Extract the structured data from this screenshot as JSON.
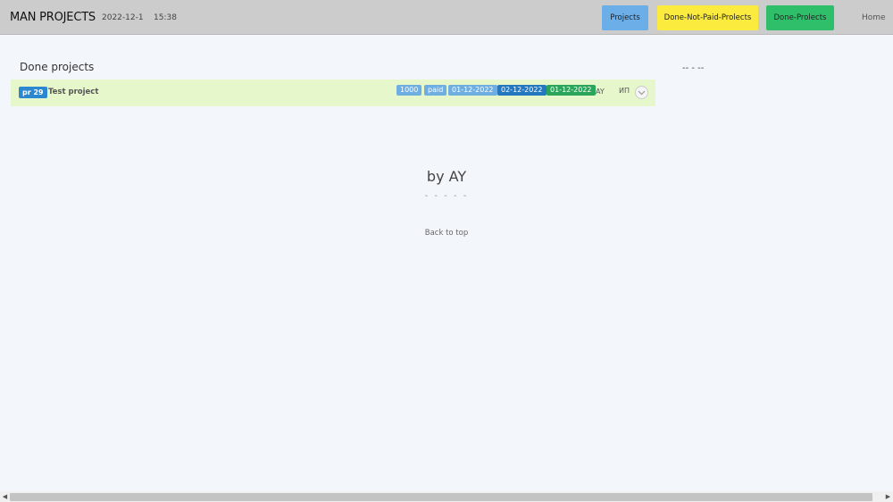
{
  "nav": {
    "brand": "MAN PROJECTS",
    "date": "2022-12-1",
    "time": "15:38",
    "buttons": [
      {
        "label": "Projects",
        "color": "#6caee8"
      },
      {
        "label": "Done-Not-Paid-Prolects",
        "color": "#fbeb3e"
      },
      {
        "label": "Done-Prolects",
        "color": "#2fbf6a"
      }
    ],
    "home_label": "Home"
  },
  "main": {
    "section_title": "Done projects",
    "side_dashes": "-- - --",
    "project": {
      "id_label": "pr 29",
      "name": "Test project",
      "amount": "1000",
      "status": "paid",
      "date1": "01-12-2022",
      "date2": "02-12-2022",
      "date3": "01-12-2022",
      "author": "AY",
      "org": "ИП"
    }
  },
  "footer": {
    "title": "by AY",
    "dashes": "- - - - -",
    "back_to_top": "Back to top"
  },
  "colors": {
    "navbar_bg": "#cccccc",
    "row_bg": "#e6f7cb",
    "badge_blue": "#2b87d0"
  }
}
